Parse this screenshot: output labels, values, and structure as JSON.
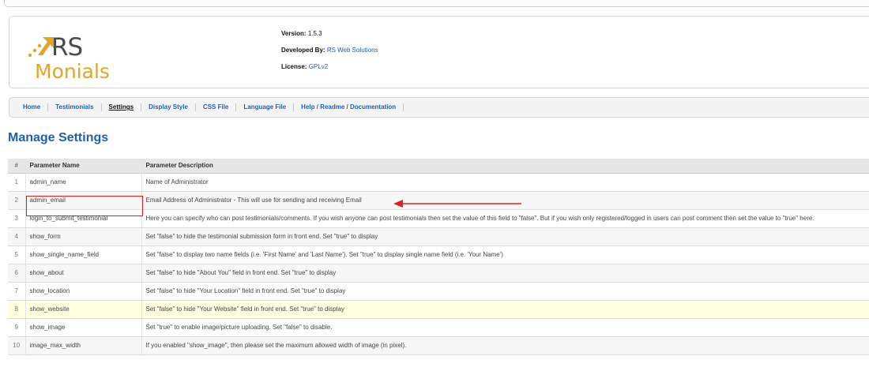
{
  "header": {
    "logo_text_top": "RS",
    "logo_text_bottom": "Monials",
    "version_label": "Version:",
    "version_value": "1.5.3",
    "developer_label": "Developed By:",
    "developer_value": "RS Web Solutions",
    "license_label": "License:",
    "license_value": "GPLv2"
  },
  "nav": {
    "tabs": [
      {
        "label": "Home"
      },
      {
        "label": "Testimonials"
      },
      {
        "label": "Settings"
      },
      {
        "label": "Display Style"
      },
      {
        "label": "CSS File"
      },
      {
        "label": "Language File"
      },
      {
        "label": "Help / Readme / Documentation"
      }
    ],
    "active_tab": "Settings"
  },
  "page": {
    "title": "Manage Settings"
  },
  "table": {
    "headers": {
      "num": "#",
      "name": "Parameter Name",
      "desc": "Parameter Description"
    },
    "rows": [
      {
        "num": "1",
        "name": "admin_name",
        "desc": "Name of Administrator"
      },
      {
        "num": "2",
        "name": "admin_email",
        "desc": "Email Address of Administrator - This will use for sending and receiving Email"
      },
      {
        "num": "3",
        "name": "login_to_submit_testimonial",
        "desc": "Here you can specify who can post testimonials/comments. If you wish anyone can post testimonials then set the value of this field to \"false\". But if you wish only registered/logged in users can post comment then set the value to \"true\" here."
      },
      {
        "num": "4",
        "name": "show_form",
        "desc": "Set \"false\" to hide the testimonial submission form in front end. Set \"true\" to display"
      },
      {
        "num": "5",
        "name": "show_single_name_field",
        "desc": "Set \"false\" to display two name fields (i.e. 'First Name' and 'Last Name'). Set \"true\" to display single name field (i.e. 'Your Name')"
      },
      {
        "num": "6",
        "name": "show_about",
        "desc": "Set \"false\" to hide \"About You\" field in front end. Set \"true\" to display"
      },
      {
        "num": "7",
        "name": "show_location",
        "desc": "Set \"false\" to hide \"Your Location\" field in front end. Set \"true\" to display"
      },
      {
        "num": "8",
        "name": "show_website",
        "desc": "Set \"false\" to hide \"Your Website\" field in front end. Set \"true\" to display"
      },
      {
        "num": "9",
        "name": "show_image",
        "desc": "Set \"true\" to enable image/picture uploading. Set \"false\" to disable."
      },
      {
        "num": "10",
        "name": "image_max_width",
        "desc": "If you enabled \"show_image\", then please set the maximum allowed width of image (in pixel)."
      }
    ]
  },
  "colors": {
    "link_blue": "#1f5fb0",
    "logo_orange": "#e2a525",
    "highlight_row": "#ffffe0",
    "annotation_red": "#e02020"
  }
}
